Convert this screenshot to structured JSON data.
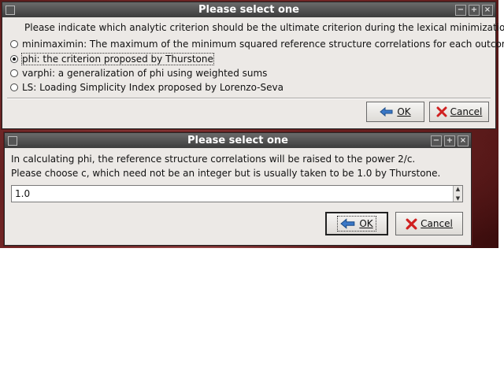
{
  "dialog1": {
    "title": "Please select one",
    "controls": [
      "−",
      "+",
      "×"
    ],
    "prompt": "Please indicate which analytic criterion should be the ultimate criterion during the lexical minimization.",
    "options": [
      {
        "label": "minimaximin: The maximum of the minimum squared reference structure correlations for each outcome.",
        "selected": false
      },
      {
        "label": "phi: the criterion proposed by Thurstone",
        "selected": true
      },
      {
        "label": "varphi: a generalization of phi using weighted sums",
        "selected": false
      },
      {
        "label": "LS: Loading Simplicity Index proposed by Lorenzo-Seva",
        "selected": false
      }
    ],
    "ok_label": "OK",
    "cancel_label": "Cancel"
  },
  "dialog2": {
    "title": "Please select one",
    "controls": [
      "−",
      "+",
      "×"
    ],
    "message_line1": "In calculating phi, the reference structure correlations will be raised to the power 2/c.",
    "message_line2": "Please choose c, which need not be an integer but is usually taken to be 1.0 by Thurstone.",
    "input_value": "1.0",
    "ok_label": "OK",
    "cancel_label": "Cancel"
  },
  "colors": {
    "titlebar": "#3c3c3c",
    "window_bg": "#ece9e6",
    "ok_icon": "#3a78c8",
    "cancel_icon": "#d02020"
  }
}
